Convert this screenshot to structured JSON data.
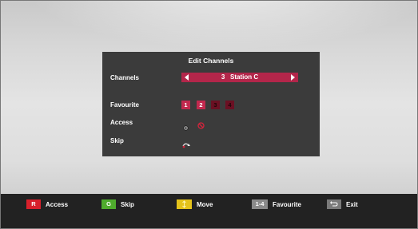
{
  "dialog": {
    "title": "Edit Channels",
    "channels_label": "Channels",
    "channel_value": "3   Station C",
    "favourite_label": "Favourite",
    "favourites": [
      {
        "label": "1",
        "active": true
      },
      {
        "label": "2",
        "active": true
      },
      {
        "label": "3",
        "active": false
      },
      {
        "label": "4",
        "active": false
      }
    ],
    "access_label": "Access",
    "skip_label": "Skip"
  },
  "footer": {
    "access_key": "R",
    "access_label": "Access",
    "skip_key": "G",
    "skip_label": "Skip",
    "move_label": "Move",
    "favourite_key": "1-4",
    "favourite_label": "Favourite",
    "exit_label": "Exit"
  },
  "colors": {
    "red_key": "#d8202b",
    "green_key": "#4fab2d",
    "yellow_key": "#e5c31a",
    "grey_key": "#8a8a8a",
    "accent": "#b3264a"
  }
}
